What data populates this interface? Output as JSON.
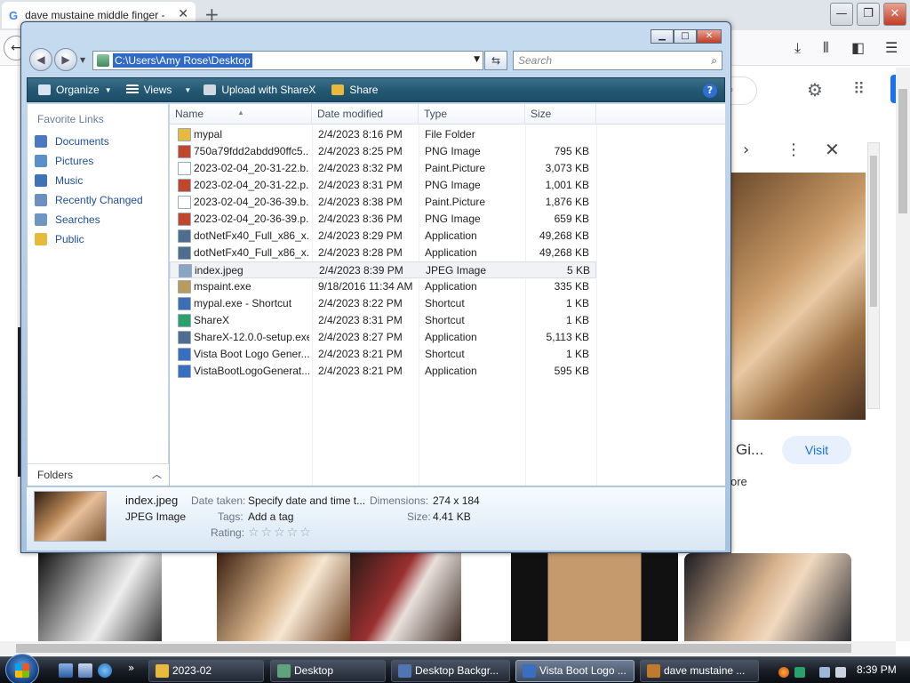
{
  "browser": {
    "tab_title": "dave mustaine middle finger -",
    "tab_close": "✕",
    "new_tab": "+",
    "google_letter": "G",
    "knowledge_panel": {
      "title_fragment": "Gi...",
      "visit_label": "Visit",
      "more_fragment": "ore"
    }
  },
  "explorer": {
    "address": "C:\\Users\\Amy Rose\\Desktop",
    "search_placeholder": "Search",
    "toolbar": {
      "organize": "Organize",
      "views": "Views",
      "upload": "Upload with ShareX",
      "share": "Share",
      "help": "?"
    },
    "nav": {
      "header": "Favorite Links",
      "items": [
        {
          "label": "Documents",
          "color": "#4a79c2"
        },
        {
          "label": "Pictures",
          "color": "#5b8fc9"
        },
        {
          "label": "Music",
          "color": "#3f73b8"
        },
        {
          "label": "Recently Changed",
          "color": "#6a8fc0"
        },
        {
          "label": "Searches",
          "color": "#6f95c4"
        },
        {
          "label": "Public",
          "color": "#e7b93c"
        }
      ],
      "folders_label": "Folders"
    },
    "columns": {
      "name": "Name",
      "date": "Date modified",
      "type": "Type",
      "size": "Size"
    },
    "files": [
      {
        "name": "mypal",
        "date": "2/4/2023 8:16 PM",
        "type": "File Folder",
        "size": "",
        "icon_color": "#e7b93c"
      },
      {
        "name": "750a79fdd2abdd90ffc5...",
        "date": "2/4/2023 8:25 PM",
        "type": "PNG Image",
        "size": "795 KB",
        "icon_color": "#c0462c"
      },
      {
        "name": "2023-02-04_20-31-22.b...",
        "date": "2/4/2023 8:32 PM",
        "type": "Paint.Picture",
        "size": "3,073 KB",
        "icon_color": "#ffffff"
      },
      {
        "name": "2023-02-04_20-31-22.p...",
        "date": "2/4/2023 8:31 PM",
        "type": "PNG Image",
        "size": "1,001 KB",
        "icon_color": "#c0462c"
      },
      {
        "name": "2023-02-04_20-36-39.b...",
        "date": "2/4/2023 8:38 PM",
        "type": "Paint.Picture",
        "size": "1,876 KB",
        "icon_color": "#ffffff"
      },
      {
        "name": "2023-02-04_20-36-39.p...",
        "date": "2/4/2023 8:36 PM",
        "type": "PNG Image",
        "size": "659 KB",
        "icon_color": "#c0462c"
      },
      {
        "name": "dotNetFx40_Full_x86_x...",
        "date": "2/4/2023 8:29 PM",
        "type": "Application",
        "size": "49,268 KB",
        "icon_color": "#4f6d8f"
      },
      {
        "name": "dotNetFx40_Full_x86_x...",
        "date": "2/4/2023 8:28 PM",
        "type": "Application",
        "size": "49,268 KB",
        "icon_color": "#4f6d8f"
      },
      {
        "name": "index.jpeg",
        "date": "2/4/2023 8:39 PM",
        "type": "JPEG Image",
        "size": "5 KB",
        "icon_color": "#8aa5c4"
      },
      {
        "name": "mspaint.exe",
        "date": "9/18/2016 11:34 AM",
        "type": "Application",
        "size": "335 KB",
        "icon_color": "#b99b5b"
      },
      {
        "name": "mypal.exe - Shortcut",
        "date": "2/4/2023 8:22 PM",
        "type": "Shortcut",
        "size": "1 KB",
        "icon_color": "#3b6fb6"
      },
      {
        "name": "ShareX",
        "date": "2/4/2023 8:31 PM",
        "type": "Shortcut",
        "size": "1 KB",
        "icon_color": "#2aa06b"
      },
      {
        "name": "ShareX-12.0.0-setup.exe",
        "date": "2/4/2023 8:27 PM",
        "type": "Application",
        "size": "5,113 KB",
        "icon_color": "#4f6d8f"
      },
      {
        "name": "Vista Boot Logo Gener...",
        "date": "2/4/2023 8:21 PM",
        "type": "Shortcut",
        "size": "1 KB",
        "icon_color": "#3a6ec0"
      },
      {
        "name": "VistaBootLogoGenerat...",
        "date": "2/4/2023 8:21 PM",
        "type": "Application",
        "size": "595 KB",
        "icon_color": "#3a6ec0"
      }
    ],
    "details": {
      "filename": "index.jpeg",
      "filetype": "JPEG Image",
      "date_taken_label": "Date taken:",
      "date_taken_value": "Specify date and time t...",
      "tags_label": "Tags:",
      "tags_value": "Add a tag",
      "rating_label": "Rating:",
      "rating_stars": "☆☆☆☆☆",
      "dimensions_label": "Dimensions:",
      "dimensions_value": "274 x 184",
      "size_label": "Size:",
      "size_value": "4.41 KB"
    }
  },
  "taskbar": {
    "more": "»",
    "tasks": [
      {
        "label": "2023-02",
        "icon_color": "#e7b93c",
        "active": false
      },
      {
        "label": "Desktop",
        "icon_color": "#5fa37c",
        "active": false
      },
      {
        "label": "Desktop Backgr...",
        "icon_color": "#4f76b3",
        "active": false
      },
      {
        "label": "Vista Boot Logo ...",
        "icon_color": "#3a6ec0",
        "active": true
      },
      {
        "label": "dave mustaine ...",
        "icon_color": "#c07a2c",
        "active": false
      }
    ],
    "clock": "8:39 PM"
  }
}
